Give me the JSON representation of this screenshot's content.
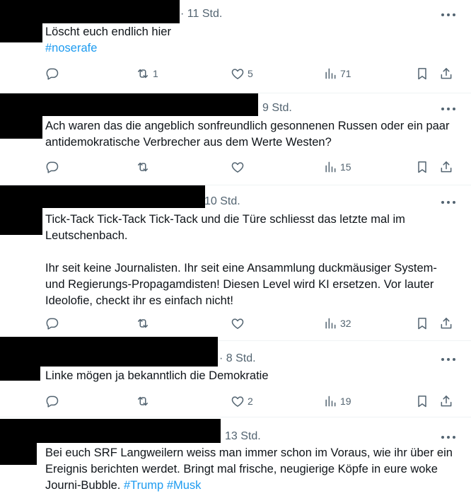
{
  "tweets": [
    {
      "time": "· 11 Std.",
      "paragraphs": [
        {
          "segments": [
            {
              "text": "Löscht euch endlich hier",
              "hashtag": false
            }
          ]
        },
        {
          "segments": [
            {
              "text": "#noserafe",
              "hashtag": true
            }
          ]
        }
      ],
      "replies": "",
      "retweets": "1",
      "likes": "5",
      "views": "71"
    },
    {
      "time": "9 Std.",
      "paragraphs": [
        {
          "segments": [
            {
              "text": "Ach waren das die angeblich sonfreundlich gesonnenen Russen oder ein paar antidemokratische Verbrecher aus dem Werte Westen?",
              "hashtag": false
            }
          ]
        }
      ],
      "replies": "",
      "retweets": "",
      "likes": "",
      "views": "15"
    },
    {
      "time": "10 Std.",
      "paragraphs": [
        {
          "segments": [
            {
              "text": "Tick-Tack Tick-Tack Tick-Tack und die Türe schliesst das letzte mal im Leutschenbach.",
              "hashtag": false
            }
          ]
        },
        {
          "blank": true
        },
        {
          "segments": [
            {
              "text": "Ihr seit keine Journalisten. Ihr seit eine Ansammlung duckmäusiger System- und Regierungs-Propagamdisten! Diesen Level wird KI ersetzen. Vor lauter Ideolofie, checkt ihr es einfach nicht!",
              "hashtag": false
            }
          ]
        }
      ],
      "replies": "",
      "retweets": "",
      "likes": "",
      "views": "32"
    },
    {
      "time": "· 8 Std.",
      "paragraphs": [
        {
          "segments": [
            {
              "text": "Linke mögen ja bekanntlich die Demokratie",
              "hashtag": false
            }
          ]
        }
      ],
      "replies": "",
      "retweets": "",
      "likes": "2",
      "views": "19"
    },
    {
      "time": "13 Std.",
      "paragraphs": [
        {
          "segments": [
            {
              "text": "Bei euch SRF Langweilern weiss man immer schon im Voraus, wie ihr über ein Ereignis berichten werdet. Bringt mal frische, neugierige Köpfe in eure woke Journi-Bubble. ",
              "hashtag": false
            },
            {
              "text": "#Trump",
              "hashtag": true
            },
            {
              "text": " ",
              "hashtag": false
            },
            {
              "text": "#Musk",
              "hashtag": true
            }
          ]
        }
      ]
    }
  ],
  "colors": {
    "text": "#0f1419",
    "secondary": "#536471",
    "hashtag": "#1d9bf0",
    "divider": "#eff3f4"
  },
  "icons": [
    "reply-icon",
    "retweet-icon",
    "like-icon",
    "views-icon",
    "bookmark-icon",
    "share-icon",
    "more-icon"
  ]
}
